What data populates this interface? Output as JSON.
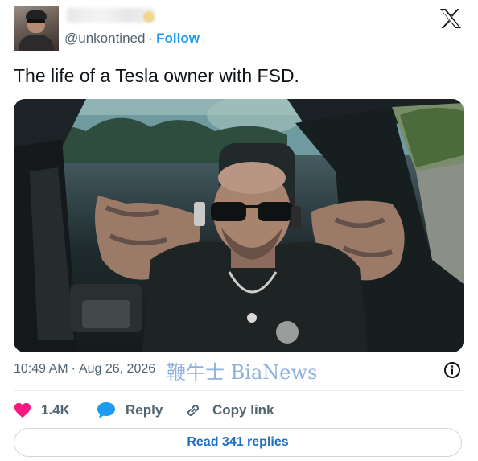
{
  "author": {
    "handle": "@unkontined",
    "follow_label": "Follow",
    "separator": "·"
  },
  "tweet": {
    "text": "The life of a Tesla owner with FSD."
  },
  "meta": {
    "time": "10:49 AM",
    "separator": "·",
    "date": "Aug 26, 2026"
  },
  "watermark": "鞭牛士 BiaNews",
  "actions": {
    "like_count": "1.4K",
    "reply_label": "Reply",
    "copy_label": "Copy link"
  },
  "read_replies_label": "Read 341 replies",
  "colors": {
    "like": "#f91880",
    "reply": "#1d9bf0",
    "follow": "#1d9bf0",
    "muted": "#536471"
  },
  "icons": [
    "x-logo-icon",
    "heart-icon",
    "reply-bubble-icon",
    "link-icon",
    "info-icon"
  ]
}
